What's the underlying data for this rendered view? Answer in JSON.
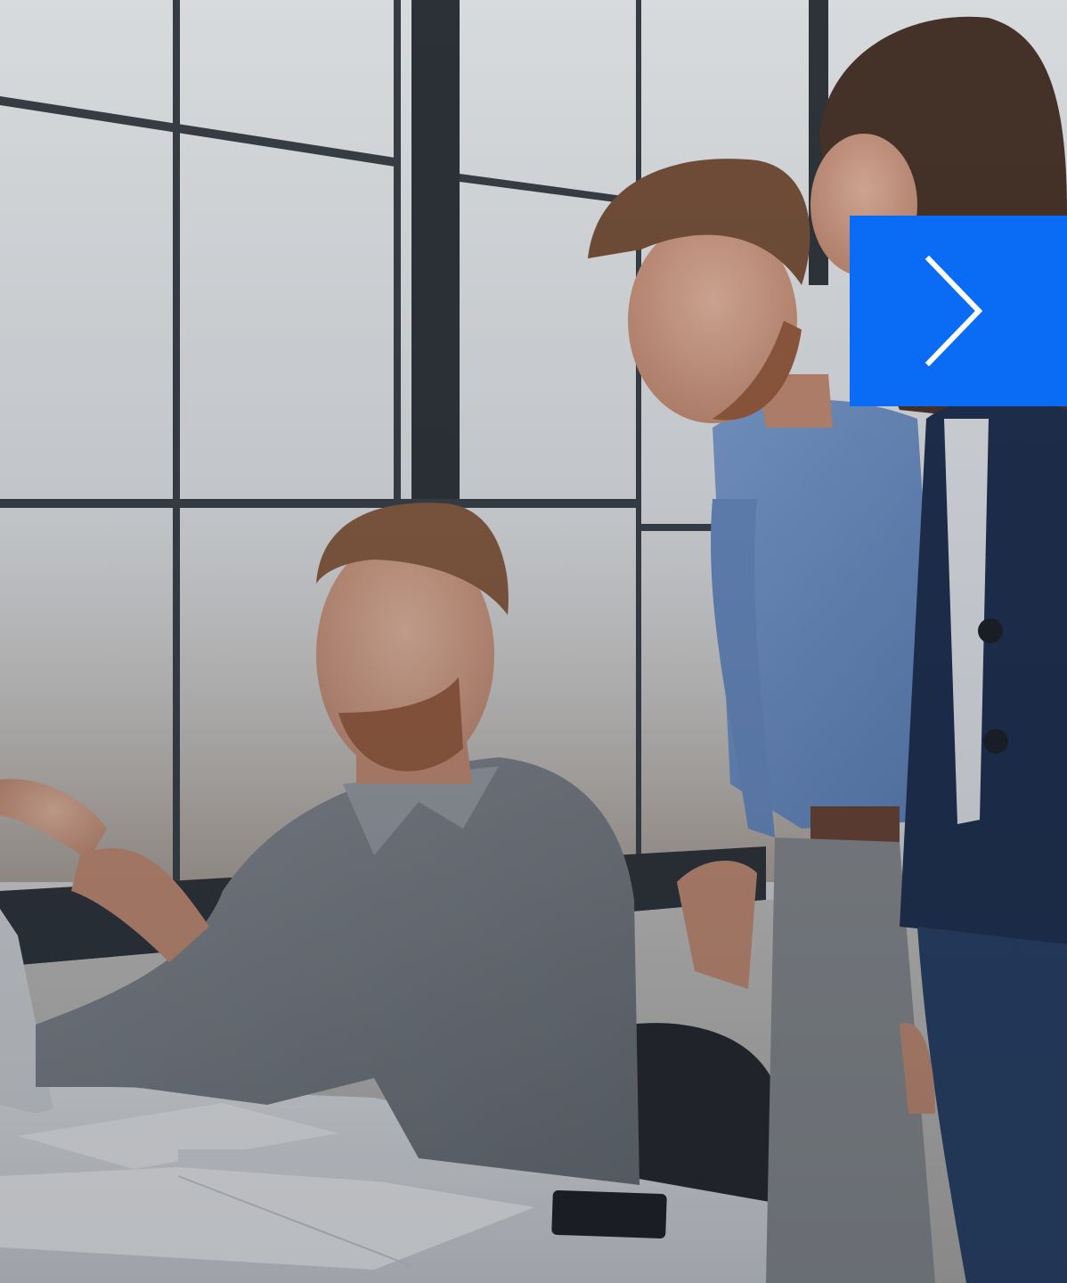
{
  "hero": {
    "image_icon": "office-team-photo",
    "colors": {
      "window_light": "#eceef0",
      "window_frame": "#3a4046",
      "shirt_grey": "#7d8287",
      "shirt_blue": "#6f93c8",
      "blazer_navy": "#1d2f4f",
      "desk_white": "#e9eaec"
    }
  },
  "carousel": {
    "next_icon": "chevron-right-icon",
    "next_label": "Next",
    "accent": "#0a6cf5"
  }
}
